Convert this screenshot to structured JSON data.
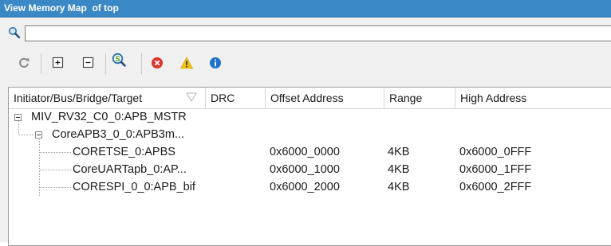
{
  "window": {
    "title": "View Memory Map  of top"
  },
  "search": {
    "value": "",
    "placeholder": ""
  },
  "toolbar": {
    "buttons": [
      {
        "name": "refresh",
        "icon": "refresh-icon"
      },
      {
        "name": "expand-all",
        "icon": "expand-all-icon"
      },
      {
        "name": "collapse-all",
        "icon": "collapse-all-icon"
      },
      {
        "name": "search-design",
        "icon": "magnifier-s-icon"
      },
      {
        "name": "show-errors",
        "icon": "error-icon"
      },
      {
        "name": "show-warnings",
        "icon": "warning-icon"
      },
      {
        "name": "show-info",
        "icon": "info-icon"
      }
    ]
  },
  "columns": {
    "target": "Initiator/Bus/Bridge/Target",
    "drc": "DRC",
    "offset": "Offset Address",
    "range": "Range",
    "high": "High Address"
  },
  "rows": [
    {
      "target": "MIV_RV32_C0_0:APB_MSTR",
      "drc": "",
      "offset": "",
      "range": "",
      "high": ""
    },
    {
      "target": "CoreAPB3_0_0:APB3m...",
      "drc": "",
      "offset": "",
      "range": "",
      "high": ""
    },
    {
      "target": "CORETSE_0:APBS",
      "drc": "",
      "offset": "0x6000_0000",
      "range": "4KB",
      "high": "0x6000_0FFF"
    },
    {
      "target": "CoreUARTapb_0:AP...",
      "drc": "",
      "offset": "0x6000_1000",
      "range": "4KB",
      "high": "0x6000_1FFF"
    },
    {
      "target": "CORESPI_0_0:APB_bif",
      "drc": "",
      "offset": "0x6000_2000",
      "range": "4KB",
      "high": "0x6000_2FFF"
    }
  ],
  "colors": {
    "titlebar": "#3a88c6",
    "panel": "#f0f0f0",
    "error": "#d9342b",
    "warning": "#f2c316",
    "info": "#1e73c8"
  }
}
